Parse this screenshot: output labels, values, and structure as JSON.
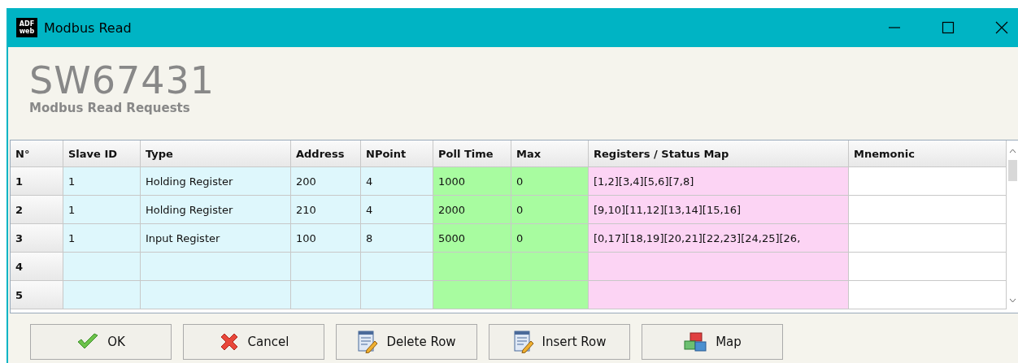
{
  "window": {
    "title": "Modbus Read",
    "logo": [
      "ADF",
      "web"
    ]
  },
  "header": {
    "title": "SW67431",
    "subtitle": "Modbus Read Requests"
  },
  "table": {
    "columns": [
      {
        "label": "N°",
        "kind": "index"
      },
      {
        "label": "Slave ID",
        "kind": "ident"
      },
      {
        "label": "Type",
        "kind": "ident"
      },
      {
        "label": "Address",
        "kind": "ident"
      },
      {
        "label": "NPoint",
        "kind": "ident"
      },
      {
        "label": "Poll Time",
        "kind": "timing"
      },
      {
        "label": "Max",
        "kind": "timing"
      },
      {
        "label": "Registers / Status Map",
        "kind": "map"
      },
      {
        "label": "Mnemonic",
        "kind": "free"
      }
    ],
    "rows": [
      [
        "1",
        "1",
        "Holding Register",
        "200",
        "4",
        "1000",
        "0",
        "[1,2][3,4][5,6][7,8]",
        ""
      ],
      [
        "2",
        "1",
        "Holding Register",
        "210",
        "4",
        "2000",
        "0",
        "[9,10][11,12][13,14][15,16]",
        ""
      ],
      [
        "3",
        "1",
        "Input Register",
        "100",
        "8",
        "5000",
        "0",
        "[0,17][18,19][20,21][22,23][24,25][26,",
        ""
      ],
      [
        "4",
        "",
        "",
        "",
        "",
        "",
        "",
        "",
        ""
      ],
      [
        "5",
        "",
        "",
        "",
        "",
        "",
        "",
        "",
        ""
      ]
    ]
  },
  "buttons": [
    {
      "label": "OK",
      "kind": "ok"
    },
    {
      "label": "Cancel",
      "kind": "cancel"
    },
    {
      "label": "Delete Row",
      "kind": "delete"
    },
    {
      "label": "Insert Row",
      "kind": "insert"
    },
    {
      "label": "Map",
      "kind": "map"
    }
  ]
}
